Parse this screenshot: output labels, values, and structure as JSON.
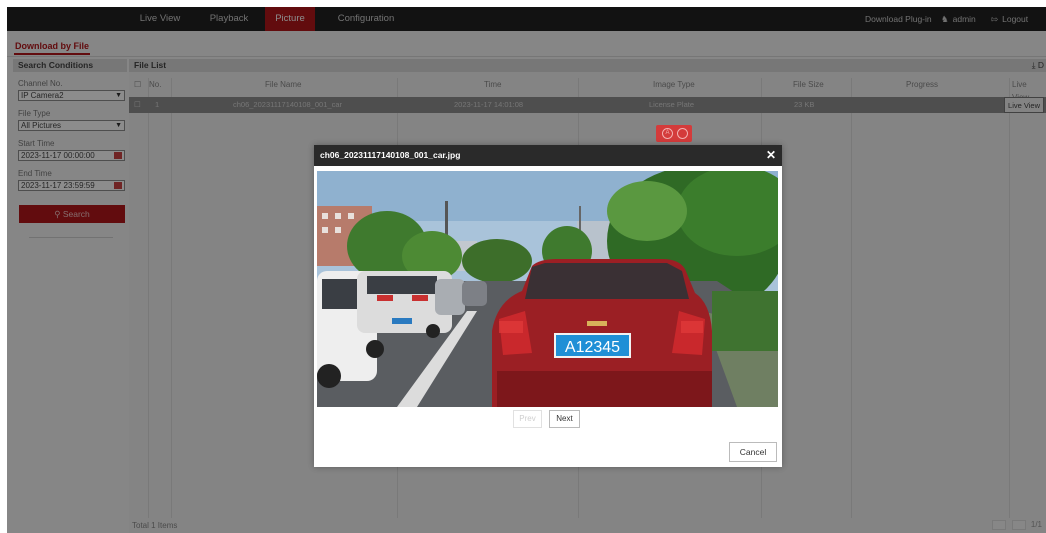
{
  "nav": {
    "tabs": [
      {
        "label": "Live View"
      },
      {
        "label": "Playback"
      },
      {
        "label": "Picture"
      },
      {
        "label": "Configuration"
      }
    ],
    "download_plugin": "Download Plug-in",
    "user": "admin",
    "logout": "Logout"
  },
  "subtab": {
    "label": "Download by File"
  },
  "search": {
    "title": "Search Conditions",
    "channel_label": "Channel No.",
    "channel_value": "IP Camera2",
    "filetype_label": "File Type",
    "filetype_value": "All Pictures",
    "start_label": "Start Time",
    "start_value": "2023-11-17 00:00:00",
    "end_label": "End Time",
    "end_value": "2023-11-17 23:59:59",
    "search_button": "Search"
  },
  "file_list": {
    "title": "File List",
    "download_label": "D",
    "columns": [
      "No.",
      "File Name",
      "Time",
      "Image Type",
      "File Size",
      "Progress",
      "Live View"
    ],
    "rows": [
      {
        "no": "1",
        "file_name": "ch06_20231117140108_001_car",
        "time": "2023-11-17 14:01:08",
        "image_type": "License Plate",
        "file_size": "23 KB",
        "progress": "",
        "live_view": "Live View"
      }
    ],
    "total": "Total 1 Items",
    "page": "1/1"
  },
  "modal": {
    "title": "ch06_20231117140108_001_car.jpg",
    "plate": "A12345",
    "prev": "Prev",
    "next": "Next",
    "cancel": "Cancel"
  },
  "colors": {
    "accent": "#b3161b",
    "nav_bg": "#222222",
    "plate_bg": "#1f8fd6"
  }
}
